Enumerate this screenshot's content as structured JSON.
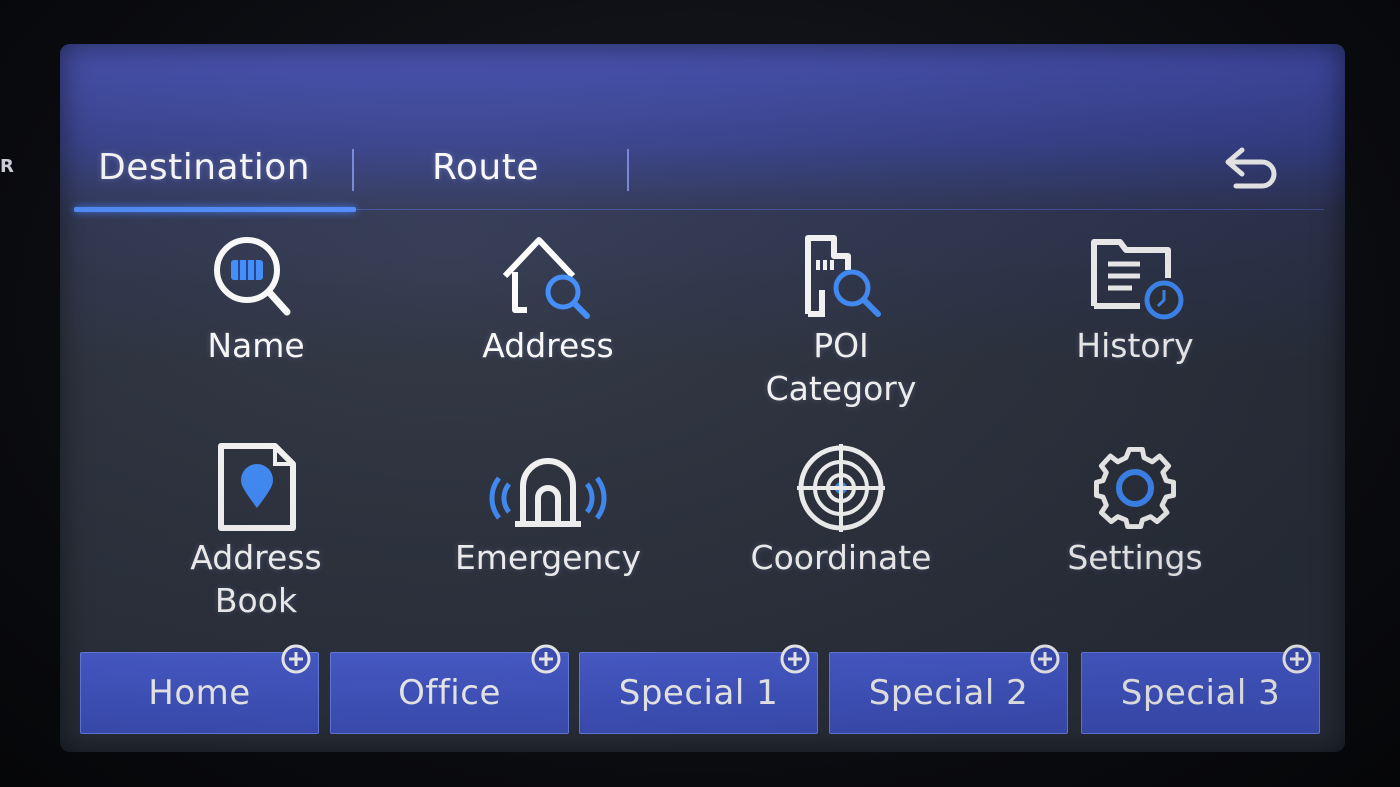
{
  "bezel": {
    "mark": "R"
  },
  "tabs": {
    "destination": "Destination",
    "route": "Route",
    "active": "Destination"
  },
  "header": {
    "back_icon": "back-arrow-icon"
  },
  "menu": [
    {
      "label": "Name",
      "icon": "search-icon"
    },
    {
      "label": "Address",
      "icon": "house-search-icon"
    },
    {
      "label": "POI\nCategory",
      "line1": "POI",
      "line2": "Category",
      "icon": "poi-search-icon"
    },
    {
      "label": "History",
      "icon": "folder-clock-icon"
    },
    {
      "label": "Address\nBook",
      "line1": "Address",
      "line2": "Book",
      "icon": "document-pin-icon"
    },
    {
      "label": "Emergency",
      "icon": "emergency-signal-icon"
    },
    {
      "label": "Coordinate",
      "icon": "crosshair-target-icon"
    },
    {
      "label": "Settings",
      "icon": "gear-icon"
    }
  ],
  "quick_buttons": [
    {
      "label": "Home",
      "icon": "plus-circle-icon"
    },
    {
      "label": "Office",
      "icon": "plus-circle-icon"
    },
    {
      "label": "Special 1",
      "icon": "plus-circle-icon"
    },
    {
      "label": "Special 2",
      "icon": "plus-circle-icon"
    },
    {
      "label": "Special 3",
      "icon": "plus-circle-icon"
    }
  ],
  "colors": {
    "accent": "#4f8cff",
    "button": "#4358cc",
    "background": "#2b313d",
    "icon_accent": "#3f8dff"
  }
}
